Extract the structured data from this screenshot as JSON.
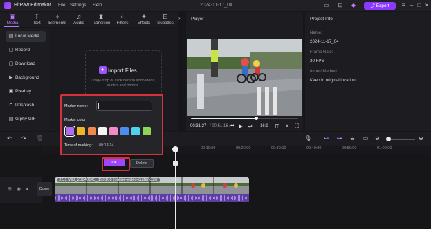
{
  "app": {
    "name": "HitPaw Edimakor",
    "project_title": "2024-11-17_04",
    "export_label": "Export"
  },
  "menu": [
    "File",
    "Settings",
    "Help"
  ],
  "tabs": [
    {
      "label": "Media",
      "icon": "media-icon"
    },
    {
      "label": "Text",
      "icon": "text-icon"
    },
    {
      "label": "Elements",
      "icon": "elements-icon"
    },
    {
      "label": "Audio",
      "icon": "audio-icon"
    },
    {
      "label": "Transition",
      "icon": "transition-icon"
    },
    {
      "label": "Filters",
      "icon": "filters-icon"
    },
    {
      "label": "Effects",
      "icon": "effects-icon"
    },
    {
      "label": "Subtitles",
      "icon": "subtitles-icon"
    }
  ],
  "sidebar": {
    "items": [
      {
        "label": "Local Media",
        "icon": "folder-icon",
        "active": true
      },
      {
        "label": "Record",
        "icon": "record-icon"
      },
      {
        "label": "Download",
        "icon": "download-icon"
      },
      {
        "label": "Background",
        "icon": "background-icon"
      },
      {
        "label": "Pixabay",
        "icon": "pixabay-icon"
      },
      {
        "label": "Unsplash",
        "icon": "unsplash-icon"
      },
      {
        "label": "Giphy GIF",
        "icon": "giphy-icon"
      }
    ]
  },
  "media": {
    "import_label": "Import Files",
    "import_hint": "Drag&drop or click here to add videos, audios and photos."
  },
  "player": {
    "title": "Player",
    "time_current": "00:31:27",
    "time_total": "/ 00:51:16",
    "speed": "16:9",
    "progress": 0.61
  },
  "project_info": {
    "title": "Project Info",
    "fields": [
      {
        "label": "Name:",
        "value": "2024-11-17_04"
      },
      {
        "label": "Frame Rate:",
        "value": "30 FPS"
      },
      {
        "label": "Import Method:",
        "value": "Keep in original location"
      }
    ]
  },
  "timeline": {
    "ticks": [
      "00:10:00",
      "00:20:00",
      "00:30:00",
      "00:40:00",
      "00:50:00",
      "01:00:00"
    ],
    "cover_label": "Cover",
    "clip_name": "0:51 VID_20240845_190106 (online-video-cutter.com)",
    "zoom": 0.2
  },
  "marker_dialog": {
    "name_label": "Marker name:",
    "name_value": "",
    "color_label": "Marker color",
    "colors": [
      "#b06cf2",
      "#f0b429",
      "#f08a4b",
      "#f4f4f4",
      "#f28ac7",
      "#4d8df0",
      "#4fd1e8",
      "#8fd35a"
    ],
    "selected_color": 0,
    "time_label": "Time of marking:",
    "time_value": "00:14:14",
    "ok_label": "OK",
    "delete_label": "Delete"
  }
}
